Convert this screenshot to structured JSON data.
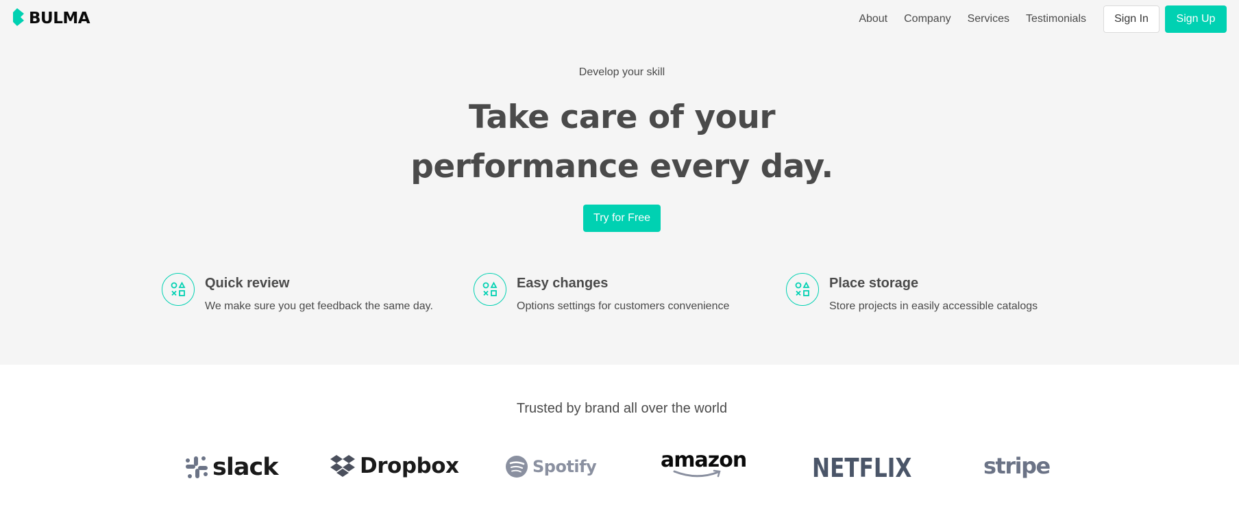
{
  "navbar": {
    "brand": "BULMA",
    "links": [
      "About",
      "Company",
      "Services",
      "Testimonials"
    ],
    "signin_label": "Sign In",
    "signup_label": "Sign Up"
  },
  "hero": {
    "subtitle": "Develop your skill",
    "headline_line1": "Take care of your",
    "headline_line2": "performance every day.",
    "cta_label": "Try for Free"
  },
  "features": [
    {
      "title": "Quick review",
      "description": "We make sure you get feedback the same day.",
      "icon": "shapes-icon"
    },
    {
      "title": "Easy changes",
      "description": "Options settings for customers convenience",
      "icon": "shapes-icon"
    },
    {
      "title": "Place storage",
      "description": "Store projects in easily accessible catalogs",
      "icon": "shapes-icon"
    }
  ],
  "trusted": {
    "heading": "Trusted by brand all over the world",
    "logos": [
      "slack",
      "Dropbox",
      "Spotify",
      "amazon",
      "NETFLIX",
      "stripe"
    ]
  },
  "colors": {
    "accent": "#00d1b2",
    "hero_bg": "#f5f5f5",
    "text": "#4a4a4a",
    "logo_gray": "#6b7386"
  }
}
